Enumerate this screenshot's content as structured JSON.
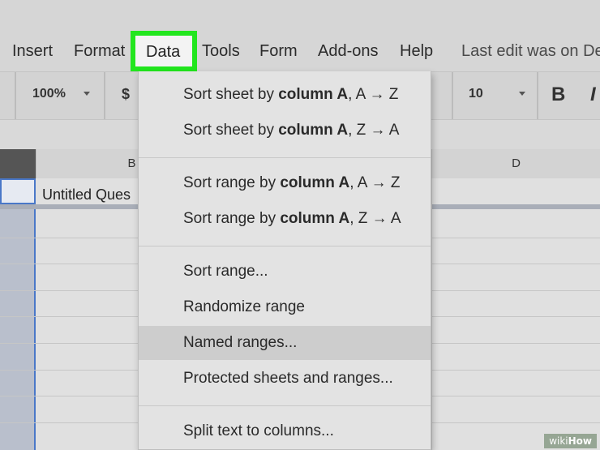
{
  "menubar": {
    "items": [
      "Insert",
      "Format",
      "Data",
      "Tools",
      "Form",
      "Add-ons",
      "Help"
    ],
    "active_item": "Data",
    "last_edit": "Last edit was on De"
  },
  "toolbar": {
    "zoom": "100%",
    "currency": "$",
    "font_size": "10",
    "bold": "B",
    "italic": "I"
  },
  "sheet": {
    "column_headers": [
      "B",
      "D"
    ],
    "cell_b1": "Untitled Ques"
  },
  "data_menu": {
    "items": [
      {
        "pre": "Sort sheet by ",
        "bold": "column A",
        "post": ", A → Z"
      },
      {
        "pre": "Sort sheet by ",
        "bold": "column A",
        "post": ", Z → A"
      },
      {
        "pre": "Sort range by ",
        "bold": "column A",
        "post": ", A → Z"
      },
      {
        "pre": "Sort range by ",
        "bold": "column A",
        "post": ", Z → A"
      },
      {
        "pre": "Sort range...",
        "bold": "",
        "post": ""
      },
      {
        "pre": "Randomize range",
        "bold": "",
        "post": ""
      },
      {
        "pre": "Named ranges...",
        "bold": "",
        "post": ""
      },
      {
        "pre": "Protected sheets and ranges...",
        "bold": "",
        "post": ""
      },
      {
        "pre": "Split text to columns...",
        "bold": "",
        "post": ""
      }
    ],
    "highlighted_index": 6
  },
  "colors": {
    "highlight_border": "#22e61e",
    "selection_blue": "#4a78c8"
  },
  "watermark": {
    "prefix": "wiki",
    "brand": "How"
  }
}
